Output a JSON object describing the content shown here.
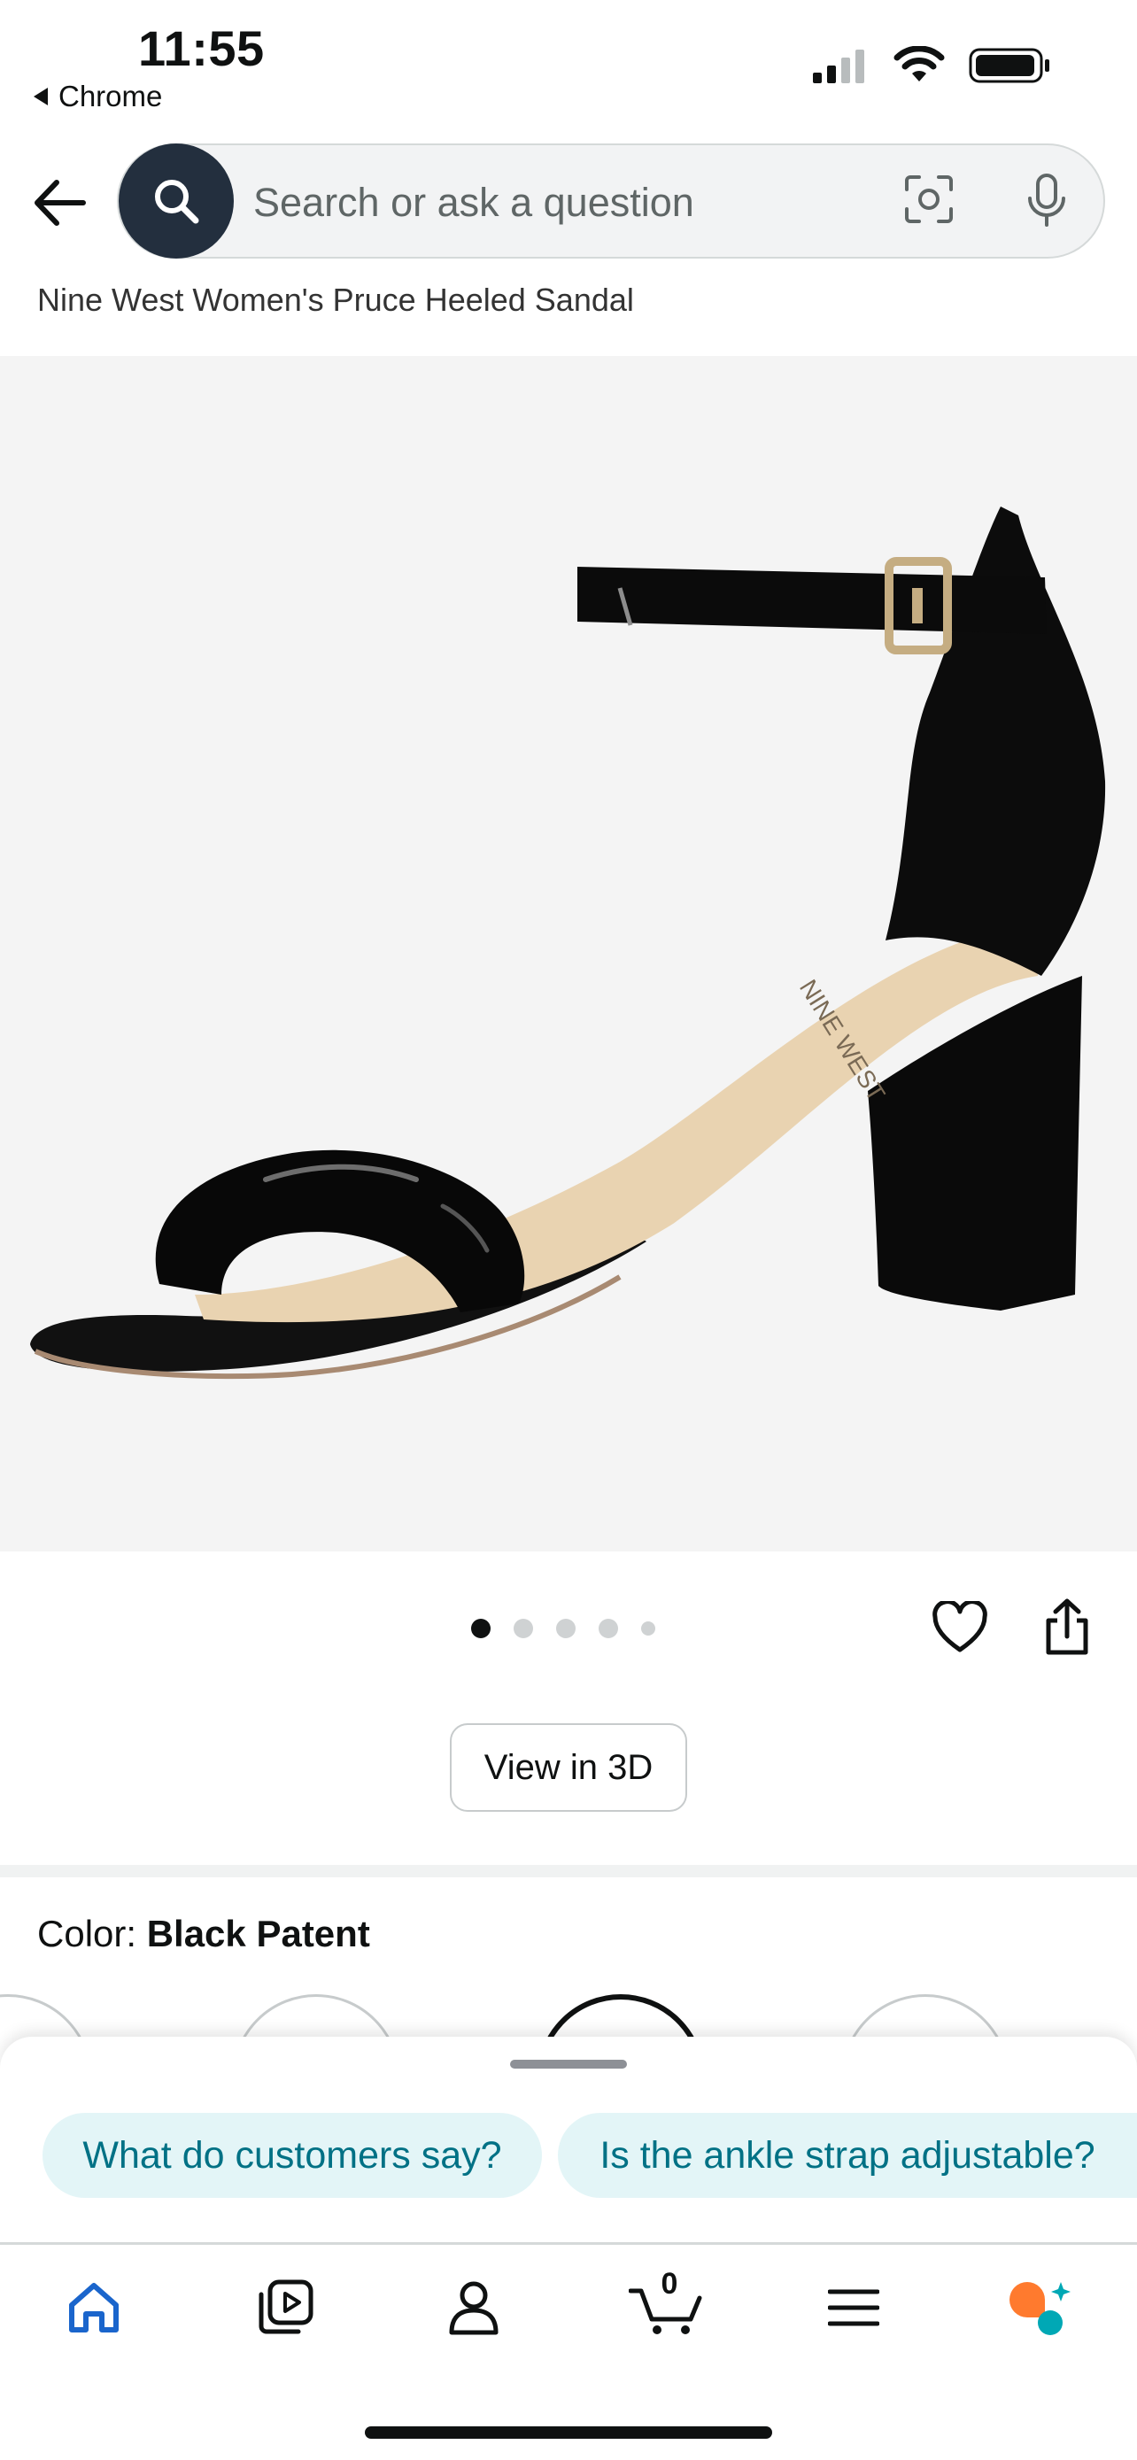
{
  "status_bar": {
    "time": "11:55",
    "back_app": "Chrome",
    "icons": [
      "signal-icon",
      "wifi-icon",
      "battery-icon"
    ]
  },
  "search": {
    "placeholder": "Search or ask a question",
    "icons": [
      "back-arrow-icon",
      "search-icon",
      "camera-icon",
      "microphone-icon"
    ]
  },
  "breadcrumb": "Nine West Women's Pruce Heeled Sandal",
  "product_image": {
    "subject": "black patent heeled sandal",
    "brand_print": "NINE WEST",
    "image_index": 1,
    "image_count": 5
  },
  "actions": {
    "view_3d_label": "View in 3D",
    "icons": [
      "heart-icon",
      "share-icon"
    ]
  },
  "color": {
    "label": "Color: ",
    "value": "Black Patent"
  },
  "suggestions": [
    "What do customers say?",
    "Is the ankle strap adjustable?"
  ],
  "bottom_nav": {
    "items": [
      "home-icon",
      "video-icon",
      "account-icon",
      "cart-icon",
      "menu-icon",
      "rufus-icon"
    ],
    "cart_count": "0",
    "accent": "#1a65cc"
  },
  "colors": {
    "search_button": "#232f3e",
    "chip_bg": "#e3f5f7",
    "chip_text": "#007185",
    "rufus_orange": "#ff7a2e",
    "rufus_teal": "#00a8b5"
  }
}
